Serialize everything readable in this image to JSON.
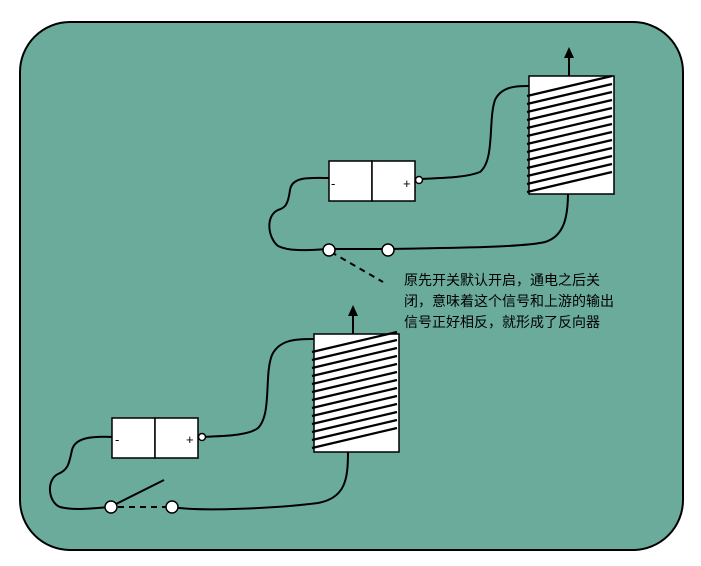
{
  "colors": {
    "panel_fill": "#6AAB9C",
    "stroke": "#000000",
    "component_fill": "#ffffff"
  },
  "top_circuit": {
    "battery": {
      "negative_label": "-",
      "positive_label": "+"
    }
  },
  "bottom_circuit": {
    "battery": {
      "negative_label": "-",
      "positive_label": "+"
    }
  },
  "annotation": {
    "lines": [
      "原先开关默认开启，通电之后关",
      "闭，意味着这个信号和上游的输出",
      "信号正好相反，就形成了反向器"
    ]
  }
}
